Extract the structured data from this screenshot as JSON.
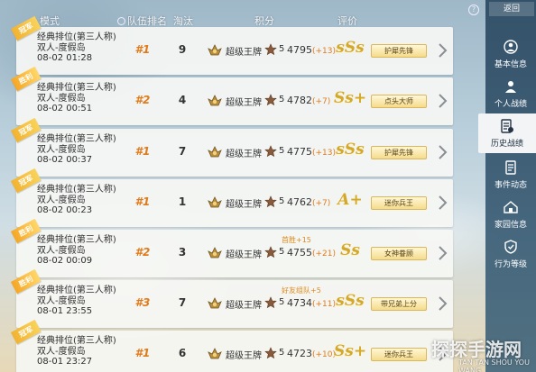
{
  "header": {
    "mode": "模式",
    "team_rank": "队伍排名",
    "kills": "淘汰",
    "score": "积分",
    "rating": "评价"
  },
  "sidebar": {
    "back": "返回",
    "items": [
      {
        "label": "基本信息",
        "icon": "person-card-icon"
      },
      {
        "label": "个人战绩",
        "icon": "person-stats-icon"
      },
      {
        "label": "历史战绩",
        "icon": "history-doc-icon",
        "active": true
      },
      {
        "label": "事件动态",
        "icon": "event-doc-icon"
      },
      {
        "label": "家园信息",
        "icon": "home-icon"
      },
      {
        "label": "行为等级",
        "icon": "shield-level-icon"
      }
    ]
  },
  "matches": [
    {
      "badge": "冠军",
      "mode": "经典排位(第三人称)",
      "map": "双人-度假岛",
      "time": "08-02 01:28",
      "rank": "#1",
      "kills": "9",
      "tier": "超级王牌",
      "tier_level": "5",
      "score": "4795",
      "delta": "(+13)",
      "grade": "sSs",
      "title": "护犀先锋",
      "bonus": ""
    },
    {
      "badge": "胜利",
      "mode": "经典排位(第三人称)",
      "map": "双人-度假岛",
      "time": "08-02 00:51",
      "rank": "#2",
      "kills": "4",
      "tier": "超级王牌",
      "tier_level": "5",
      "score": "4782",
      "delta": "(+7)",
      "grade": "Ss+",
      "title": "点头大师",
      "bonus": ""
    },
    {
      "badge": "冠军",
      "mode": "经典排位(第三人称)",
      "map": "双人-度假岛",
      "time": "08-02 00:37",
      "rank": "#1",
      "kills": "7",
      "tier": "超级王牌",
      "tier_level": "5",
      "score": "4775",
      "delta": "(+13)",
      "grade": "sSs",
      "title": "护犀先锋",
      "bonus": ""
    },
    {
      "badge": "冠军",
      "mode": "经典排位(第三人称)",
      "map": "双人-度假岛",
      "time": "08-02 00:23",
      "rank": "#1",
      "kills": "1",
      "tier": "超级王牌",
      "tier_level": "5",
      "score": "4762",
      "delta": "(+7)",
      "grade": "A+",
      "title": "迷你兵王",
      "bonus": ""
    },
    {
      "badge": "胜利",
      "mode": "经典排位(第三人称)",
      "map": "双人-度假岛",
      "time": "08-02 00:09",
      "rank": "#2",
      "kills": "3",
      "tier": "超级王牌",
      "tier_level": "5",
      "score": "4755",
      "delta": "(+21)",
      "grade": "Ss",
      "title": "女神眷顾",
      "bonus": "首胜+15"
    },
    {
      "badge": "胜利",
      "mode": "经典排位(第三人称)",
      "map": "双人-度假岛",
      "time": "08-01 23:55",
      "rank": "#3",
      "kills": "7",
      "tier": "超级王牌",
      "tier_level": "5",
      "score": "4734",
      "delta": "(+11)",
      "grade": "sSs",
      "title": "带兄弟上分",
      "bonus": "好友组队+5"
    },
    {
      "badge": "冠军",
      "mode": "经典排位(第三人称)",
      "map": "双人-度假岛",
      "time": "08-01 23:27",
      "rank": "#1",
      "kills": "6",
      "tier": "超级王牌",
      "tier_level": "5",
      "score": "4723",
      "delta": "(+10)",
      "grade": "Ss+",
      "title": "迷你兵王",
      "bonus": ""
    }
  ],
  "watermark": {
    "main": "探探手游网",
    "sub": "TAN TAN SHOU YOU WANG"
  },
  "colors": {
    "accent": "#e07b1c",
    "grade": "#d4a82a",
    "sidebar": "#2c4c63",
    "ribbon": "#f2b230"
  }
}
